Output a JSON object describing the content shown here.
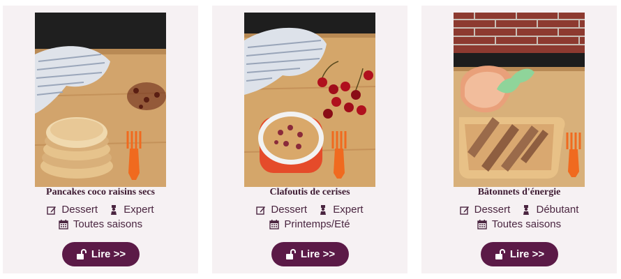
{
  "cards": [
    {
      "title": "Pancakes coco raisins secs",
      "category": "Dessert",
      "level": "Expert",
      "season": "Toutes saisons",
      "button_label": "Lire >>",
      "image_subject": "pancakes-photo"
    },
    {
      "title": "Clafoutis de cerises",
      "category": "Dessert",
      "level": "Expert",
      "season": "Printemps/Eté",
      "button_label": "Lire >>",
      "image_subject": "clafoutis-photo"
    },
    {
      "title": "Bâtonnets d'énergie",
      "category": "Dessert",
      "level": "Débutant",
      "season": "Toutes saisons",
      "button_label": "Lire >>",
      "image_subject": "energy-bars-photo"
    }
  ],
  "icons": {
    "category": "edit-icon",
    "level": "chef-icon",
    "season": "calendar-icon",
    "button": "unlock-icon"
  },
  "colors": {
    "card_bg": "#f6f1f3",
    "button_bg": "#5b1a47",
    "title_text": "#3d1a31"
  }
}
